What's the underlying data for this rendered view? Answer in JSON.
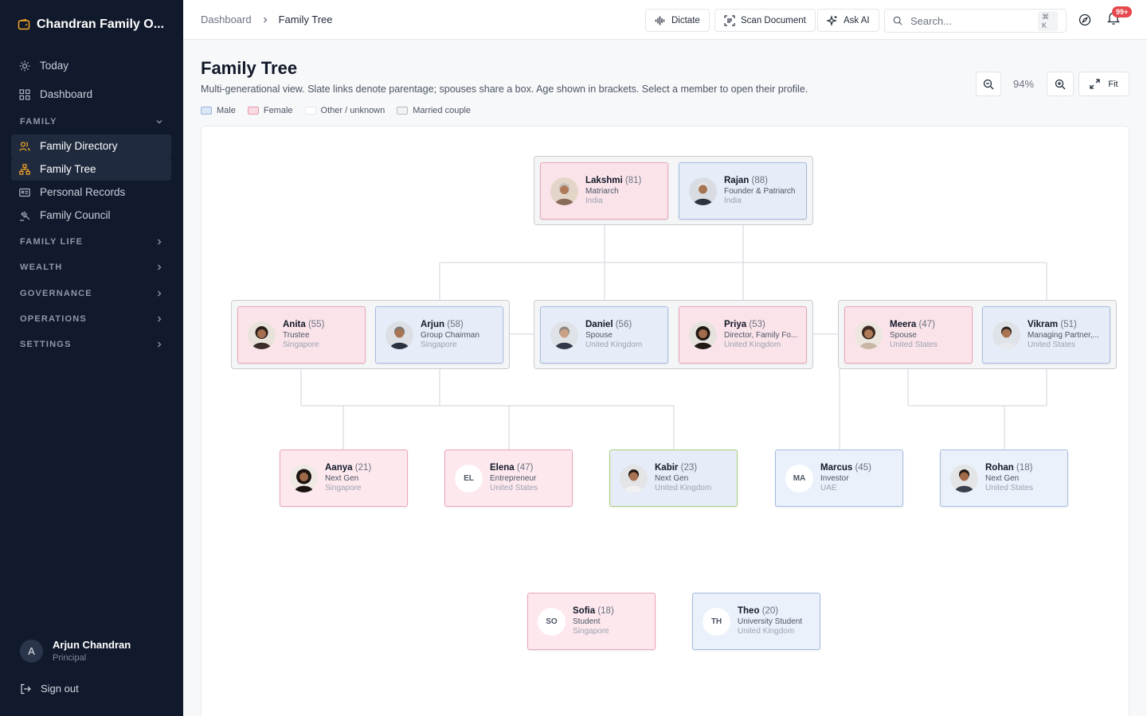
{
  "brand": {
    "title": "Chandran Family O..."
  },
  "sidebar": {
    "today": "Today",
    "dashboard": "Dashboard",
    "family_section": "FAMILY",
    "family_items": [
      "Family Directory",
      "Family Tree",
      "Personal Records",
      "Family Council"
    ],
    "sections": [
      "FAMILY LIFE",
      "WEALTH",
      "GOVERNANCE",
      "OPERATIONS",
      "SETTINGS"
    ],
    "user": {
      "initial": "A",
      "name": "Arjun Chandran",
      "role": "Principal"
    },
    "sign_out": "Sign out"
  },
  "topbar": {
    "breadcrumb": [
      "Dashboard",
      "Family Tree"
    ],
    "dictate": "Dictate",
    "scan": "Scan Document",
    "ask_ai": "Ask AI",
    "search_placeholder": "Search...",
    "shortcut": "⌘ K",
    "notifications_badge": "99+"
  },
  "page": {
    "title": "Family Tree",
    "subtitle": "Multi-generational view. Slate links denote parentage; spouses share a box. Age shown in brackets. Select a member to open their profile.",
    "legend": [
      "Male",
      "Female",
      "Other / unknown",
      "Married couple"
    ],
    "zoom": "94%",
    "fit": "Fit"
  },
  "colors": {
    "sidebar_bg": "#111a2c",
    "female_card": "#fbe3ea",
    "male_card": "#e6edf8",
    "badge": "#e5484d"
  },
  "tree": {
    "lakshmi": {
      "name": "Lakshmi",
      "age": "(81)",
      "role": "Matriarch",
      "location": "India"
    },
    "rajan": {
      "name": "Rajan",
      "age": "(88)",
      "role": "Founder & Patriarch",
      "location": "India"
    },
    "anita": {
      "name": "Anita",
      "age": "(55)",
      "role": "Trustee",
      "location": "Singapore"
    },
    "arjun": {
      "name": "Arjun",
      "age": "(58)",
      "role": "Group Chairman",
      "location": "Singapore"
    },
    "daniel": {
      "name": "Daniel",
      "age": "(56)",
      "role": "Spouse",
      "location": "United Kingdom"
    },
    "priya": {
      "name": "Priya",
      "age": "(53)",
      "role": "Director, Family Fo...",
      "location": "United Kingdom"
    },
    "meera": {
      "name": "Meera",
      "age": "(47)",
      "role": "Spouse",
      "location": "United States"
    },
    "vikram": {
      "name": "Vikram",
      "age": "(51)",
      "role": "Managing Partner,...",
      "location": "United States"
    },
    "aanya": {
      "name": "Aanya",
      "age": "(21)",
      "role": "Next Gen",
      "location": "Singapore"
    },
    "elena": {
      "name": "Elena",
      "age": "(47)",
      "role": "Entrepreneur",
      "location": "United States",
      "initials": "EL"
    },
    "kabir": {
      "name": "Kabir",
      "age": "(23)",
      "role": "Next Gen",
      "location": "United Kingdom"
    },
    "marcus": {
      "name": "Marcus",
      "age": "(45)",
      "role": "Investor",
      "location": "UAE",
      "initials": "MA"
    },
    "rohan": {
      "name": "Rohan",
      "age": "(18)",
      "role": "Next Gen",
      "location": "United States"
    },
    "sofia": {
      "name": "Sofia",
      "age": "(18)",
      "role": "Student",
      "location": "Singapore",
      "initials": "SO"
    },
    "theo": {
      "name": "Theo",
      "age": "(20)",
      "role": "University Student",
      "location": "United Kingdom",
      "initials": "TH"
    }
  }
}
